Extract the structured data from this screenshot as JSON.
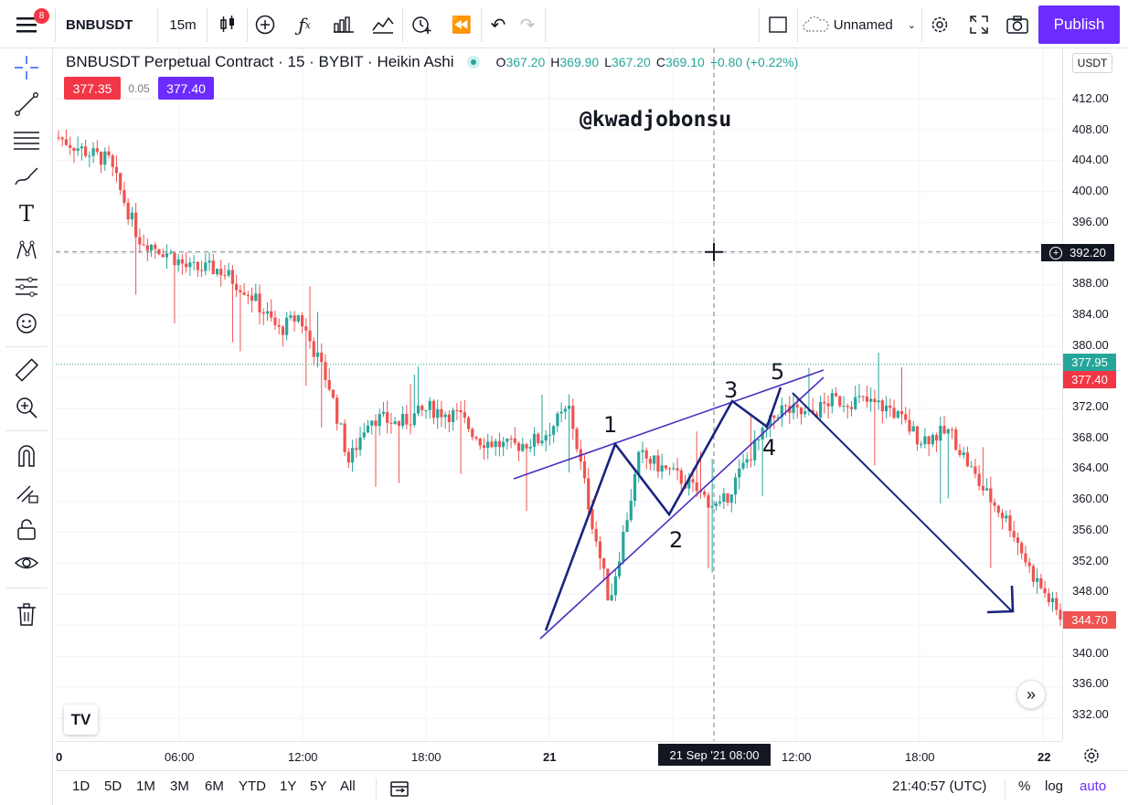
{
  "topbar": {
    "menu_badge": "8",
    "symbol": "BNBUSDT",
    "interval": "15m",
    "layout_name": "Unnamed",
    "publish_label": "Publish"
  },
  "legend": {
    "title": "BNBUSDT Perpetual Contract · 15 · BYBIT · Heikin Ashi",
    "o_key": "O",
    "o_val": "367.20",
    "h_key": "H",
    "h_val": "369.90",
    "l_key": "L",
    "l_val": "367.20",
    "c_key": "C",
    "c_val": "369.10",
    "change": "+0.80 (+0.22%)"
  },
  "price_boxes": {
    "sell": "377.35",
    "spread": "0.05",
    "buy": "377.40"
  },
  "watermark": "@kwadjobonsu",
  "yaxis": {
    "currency": "USDT",
    "labels": [
      "412.00",
      "408.00",
      "404.00",
      "400.00",
      "396.00",
      "392.00",
      "388.00",
      "384.00",
      "380.00",
      "376.00",
      "372.00",
      "368.00",
      "364.00",
      "360.00",
      "356.00",
      "352.00",
      "348.00",
      "344.00",
      "340.00",
      "336.00",
      "332.00"
    ],
    "crosshair_price": "392.20",
    "flag_green": "377.95",
    "flag_red": "377.40",
    "flag_last": "344.70"
  },
  "xaxis": {
    "labels": [
      "0",
      "06:00",
      "12:00",
      "18:00",
      "21",
      "12:00",
      "18:00",
      "22"
    ],
    "crosshair_time": "21 Sep '21   08:00"
  },
  "wave_labels": [
    "1",
    "2",
    "3",
    "4",
    "5"
  ],
  "bottombar": {
    "ranges": [
      "1D",
      "5D",
      "1M",
      "3M",
      "6M",
      "YTD",
      "1Y",
      "5Y",
      "All"
    ],
    "clock": "21:40:57 (UTC)",
    "percent": "%",
    "log": "log",
    "auto": "auto"
  },
  "colors": {
    "up": "#26a69a",
    "down": "#ef5350",
    "line": "#1a237e",
    "wedge": "#4a2fbf",
    "accent": "#6c2bff"
  },
  "icons": {
    "left_toolbar": [
      "crosshair-icon",
      "trendline-icon",
      "fib-icon",
      "brush-icon",
      "text-icon",
      "pattern-icon",
      "forecast-icon",
      "emoji-icon",
      "ruler-icon",
      "zoom-in-icon",
      "magnet-icon",
      "lock-draw-icon",
      "lock-icon",
      "eye-icon",
      "trash-icon"
    ]
  },
  "chart_data": {
    "type": "candlestick",
    "title": "BNBUSDT Perpetual Contract · 15 · BYBIT · Heikin Ashi",
    "ylim": [
      330,
      414
    ],
    "x_ticks": [
      "0",
      "06:00",
      "12:00",
      "18:00",
      "21",
      "12:00",
      "18:00",
      "22"
    ],
    "series": [
      {
        "name": "BNBUSDT",
        "close_path": [
          [
            0,
            407
          ],
          [
            0.03,
            405
          ],
          [
            0.05,
            404
          ],
          [
            0.08,
            394
          ],
          [
            0.11,
            392
          ],
          [
            0.13,
            390
          ],
          [
            0.16,
            390
          ],
          [
            0.19,
            387
          ],
          [
            0.22,
            382
          ],
          [
            0.24,
            384
          ],
          [
            0.27,
            375
          ],
          [
            0.29,
            365
          ],
          [
            0.31,
            371
          ],
          [
            0.34,
            370
          ],
          [
            0.37,
            372
          ],
          [
            0.4,
            371
          ],
          [
            0.42,
            368
          ],
          [
            0.45,
            367
          ],
          [
            0.48,
            368
          ],
          [
            0.51,
            372
          ],
          [
            0.53,
            359
          ],
          [
            0.55,
            347
          ],
          [
            0.58,
            366
          ],
          [
            0.62,
            363
          ],
          [
            0.66,
            359
          ],
          [
            0.69,
            366
          ],
          [
            0.72,
            372
          ],
          [
            0.75,
            371
          ],
          [
            0.77,
            373
          ],
          [
            0.8,
            373
          ],
          [
            0.83,
            372
          ],
          [
            0.86,
            368
          ],
          [
            0.89,
            369
          ],
          [
            0.92,
            362
          ],
          [
            0.95,
            357
          ],
          [
            0.97,
            351
          ],
          [
            0.99,
            347
          ],
          [
            1,
            345
          ]
        ]
      }
    ],
    "wave_points": [
      {
        "label": "start",
        "y": 343
      },
      {
        "label": "1",
        "y": 367
      },
      {
        "label": "2",
        "y": 358
      },
      {
        "label": "3",
        "y": 373
      },
      {
        "label": "4",
        "y": 369
      },
      {
        "label": "5",
        "y": 375
      }
    ]
  }
}
